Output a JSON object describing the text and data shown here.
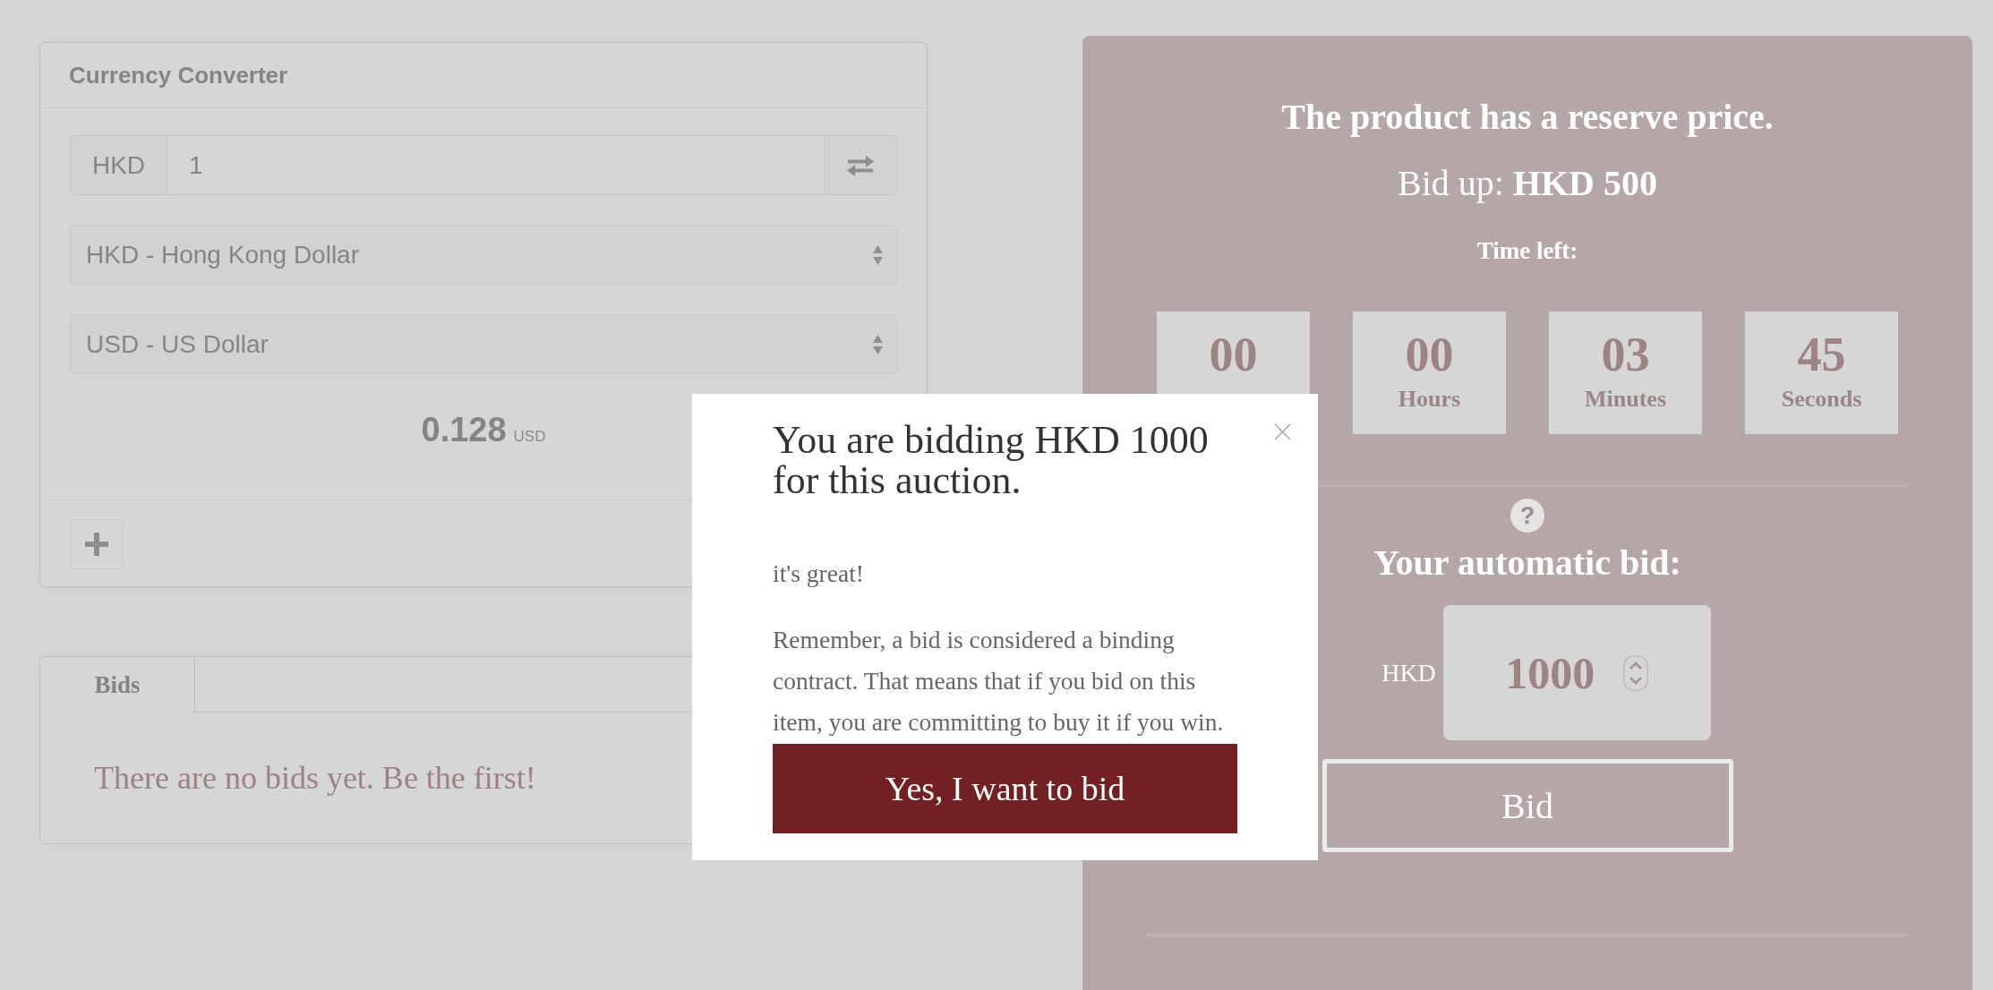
{
  "converter": {
    "title": "Currency Converter",
    "currency_code": "HKD",
    "amount": "1",
    "from_currency": "HKD - Hong Kong Dollar",
    "to_currency": "USD - US Dollar",
    "result": "0.128",
    "result_unit": "USD"
  },
  "bids": {
    "tabs": [
      {
        "label": "Bids",
        "selected": true
      }
    ],
    "empty_message": "There are no bids yet. Be the first!"
  },
  "auction": {
    "reserve_notice": "The product has a reserve price.",
    "bid_up": "Bid up: **HKD 500**",
    "time_left_label": "Time left:",
    "countdown": [
      {
        "value": "00"
      },
      {
        "value": "00",
        "unit": "Hours"
      },
      {
        "value": "03",
        "unit": "Minutes"
      },
      {
        "value": "45",
        "unit": "Seconds"
      }
    ],
    "help_icon": "?",
    "auto_bid_title": "Your automatic bid:",
    "auto_bid_currency": "HKD",
    "auto_bid_amount": "1000",
    "bid_button": "Bid"
  },
  "dialog": {
    "title": "You are bidding HKD 1000 for this auction.",
    "subtitle": "it's great!",
    "message": "Remember, a bid is considered a binding contract. That means that if you bid on this item, you are committing to buy it if you win.",
    "confirm_button": "Yes, I want to bid"
  }
}
